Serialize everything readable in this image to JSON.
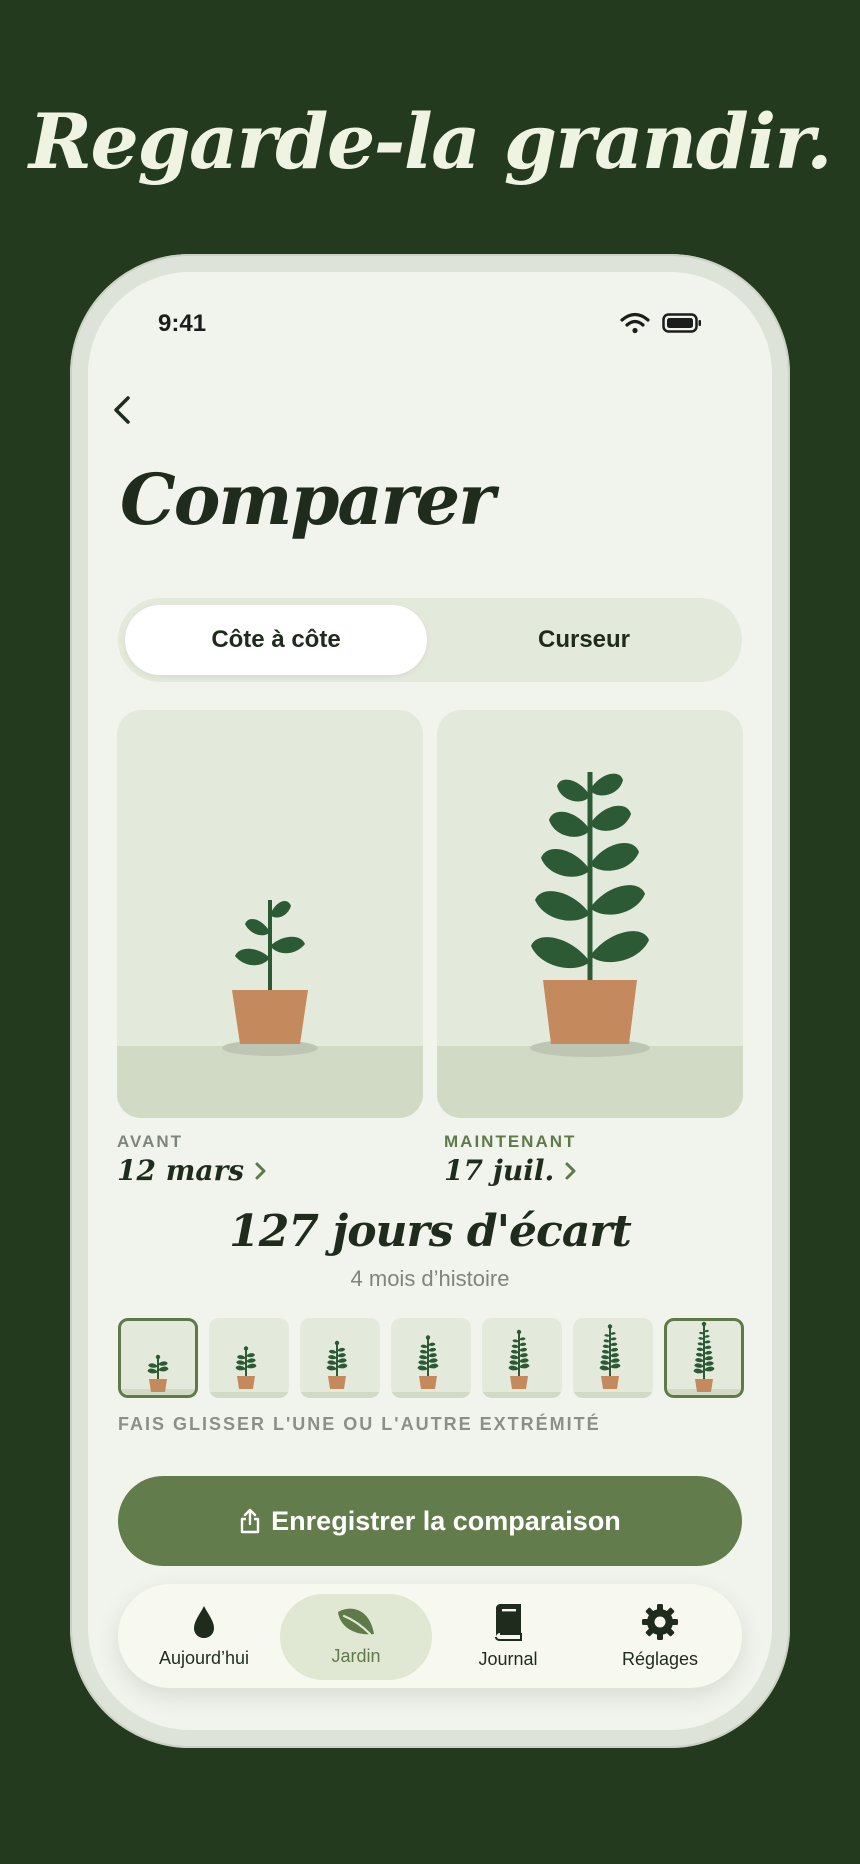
{
  "hero": {
    "headline": "Regarde-la grandir."
  },
  "status_bar": {
    "time": "9:41",
    "icons": [
      "wifi-icon",
      "battery-icon"
    ]
  },
  "nav": {
    "back_icon": "chevron-left-icon"
  },
  "page": {
    "title": "Comparer"
  },
  "segmented": {
    "options": [
      "Côte à côte",
      "Curseur"
    ],
    "selected": "Côte à côte"
  },
  "compare": {
    "before": {
      "label": "AVANT",
      "date": "12 mars"
    },
    "after": {
      "label": "MAINTENANT",
      "date": "17 juil."
    },
    "days_label": "127 jours d'écart",
    "history_label": "4 mois d’histoire"
  },
  "timeline": {
    "thumbnail_count": 7,
    "selected_indices": [
      0,
      6
    ],
    "hint": "FAIS GLISSER L'UNE OU L'AUTRE EXTRÉMITÉ"
  },
  "cta": {
    "label": "Enregistrer la comparaison",
    "icon": "share-icon"
  },
  "tabbar": {
    "items": [
      {
        "label": "Aujourd’hui",
        "icon": "water-drop-icon"
      },
      {
        "label": "Jardin",
        "icon": "leaf-icon"
      },
      {
        "label": "Journal",
        "icon": "book-icon"
      },
      {
        "label": "Réglages",
        "icon": "gear-icon"
      }
    ],
    "active": "Jardin"
  },
  "colors": {
    "background": "#243a1e",
    "accent": "#5e7a48",
    "leaf": "#2b5a35",
    "pot": "#c48a5e",
    "screen": "#f1f4ec"
  }
}
